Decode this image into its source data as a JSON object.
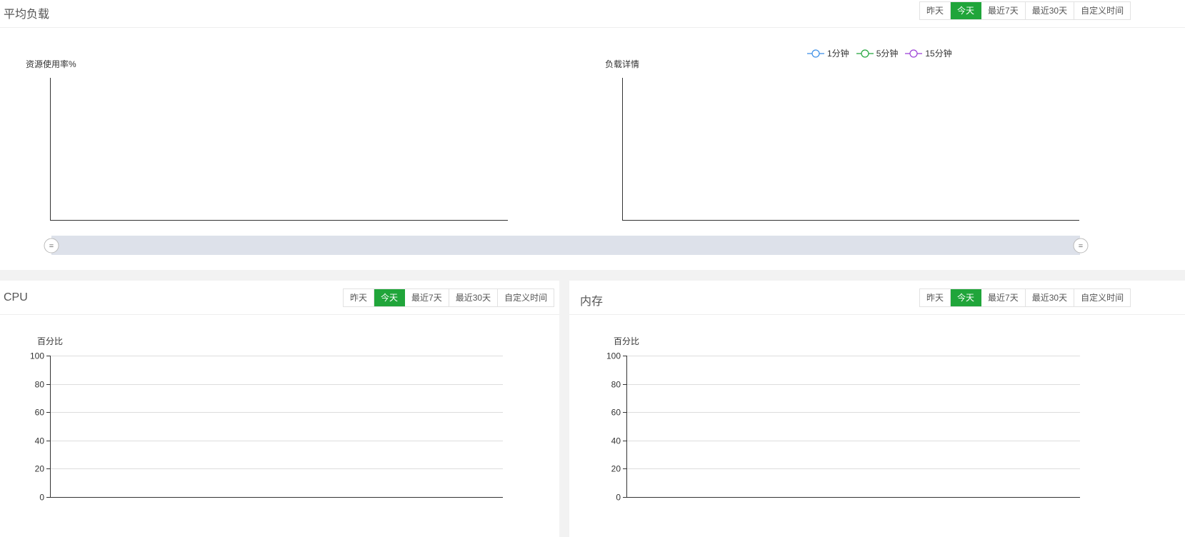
{
  "time_tabs": [
    "昨天",
    "今天",
    "最近7天",
    "最近30天",
    "自定义时间"
  ],
  "active_tab": "今天",
  "load_panel": {
    "title": "平均负载",
    "left_chart_title": "资源使用率%",
    "right_chart_title": "负载详情",
    "legend": [
      {
        "label": "1分钟",
        "color": "#3a8ee6"
      },
      {
        "label": "5分钟",
        "color": "#20a53a"
      },
      {
        "label": "15分钟",
        "color": "#9b3fd6"
      }
    ],
    "slider_handle_glyph": "="
  },
  "cpu_panel": {
    "title": "CPU",
    "ylabel": "百分比",
    "yticks": [
      "100",
      "80",
      "60",
      "40",
      "20",
      "0"
    ]
  },
  "mem_panel": {
    "title": "内存",
    "ylabel": "百分比",
    "yticks": [
      "100",
      "80",
      "60",
      "40",
      "20",
      "0"
    ]
  },
  "chart_data": [
    {
      "type": "line",
      "title": "资源使用率%",
      "series": [],
      "x": []
    },
    {
      "type": "line",
      "title": "负载详情",
      "series": [
        {
          "name": "1分钟",
          "values": []
        },
        {
          "name": "5分钟",
          "values": []
        },
        {
          "name": "15分钟",
          "values": []
        }
      ],
      "x": []
    },
    {
      "type": "line",
      "ylabel": "百分比",
      "ylim": [
        0,
        100
      ],
      "yticks": [
        0,
        20,
        40,
        60,
        80,
        100
      ],
      "series": [],
      "x": [],
      "grid": true
    },
    {
      "type": "line",
      "ylabel": "百分比",
      "ylim": [
        0,
        100
      ],
      "yticks": [
        0,
        20,
        40,
        60,
        80,
        100
      ],
      "series": [],
      "x": [],
      "grid": true
    }
  ]
}
